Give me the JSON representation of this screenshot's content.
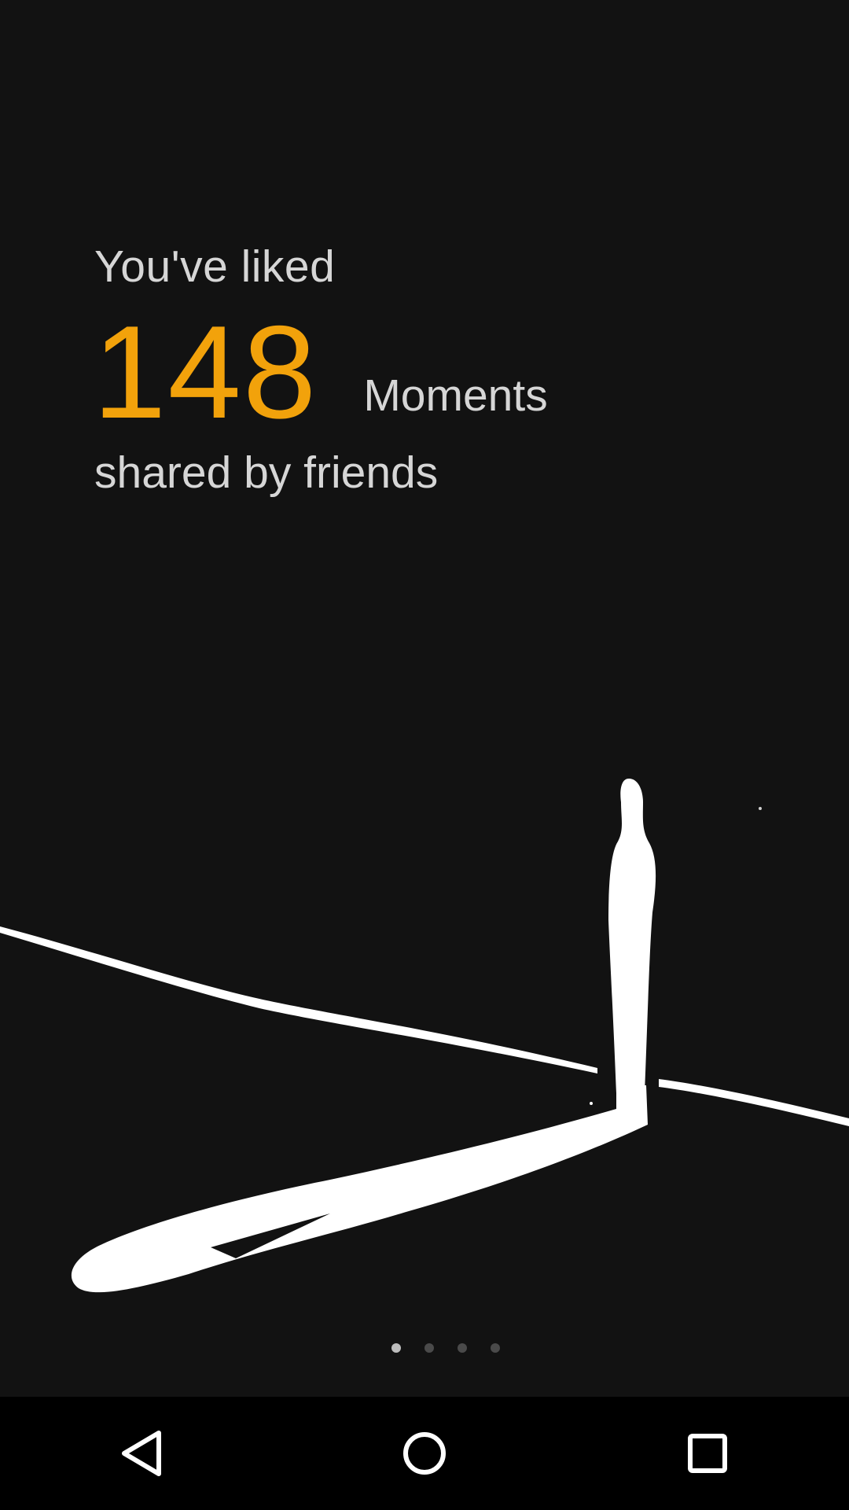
{
  "summary": {
    "headline": "You've liked",
    "count": "148",
    "unit": "Moments",
    "subline": "shared by friends"
  },
  "colors": {
    "background": "#121212",
    "accent": "#f2a20b",
    "text": "#d6d6d6",
    "navbar": "#000000"
  },
  "illustration": {
    "icon": "person-shadow-illustration"
  },
  "pager": {
    "count": 4,
    "active_index": 0
  },
  "navbar": {
    "buttons": [
      "back-icon",
      "home-icon",
      "recents-icon"
    ]
  }
}
